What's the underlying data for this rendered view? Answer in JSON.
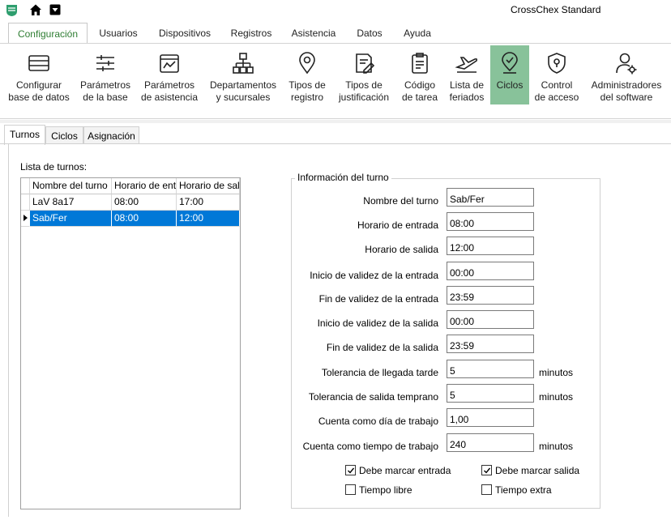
{
  "app": {
    "title": "CrossChex Standard"
  },
  "ribbon_tabs": [
    "Configuración",
    "Usuarios",
    "Dispositivos",
    "Registros",
    "Asistencia",
    "Datos",
    "Ayuda"
  ],
  "ribbon_buttons": [
    "Configurar\nbase de datos",
    "Parámetros\nde la base",
    "Parámetros\nde asistencia",
    "Departamentos\ny sucursales",
    "Tipos de\nregistro",
    "Tipos de\njustificación",
    "Código\nde tarea",
    "Lista de\nferiados",
    "Ciclos",
    "Control\nde acceso",
    "Administradores\ndel software"
  ],
  "sub_tabs": [
    "Turnos",
    "Ciclos",
    "Asignación"
  ],
  "shift_list": {
    "label": "Lista de turnos:",
    "columns": [
      "Nombre del turno",
      "Horario de ent",
      "Horario de sal"
    ],
    "rows": [
      [
        "LaV 8a17",
        "08:00",
        "17:00"
      ],
      [
        "Sab/Fer",
        "08:00",
        "12:00"
      ]
    ]
  },
  "shift_info": {
    "title": "Información del turno",
    "fields": [
      {
        "label": "Nombre del turno",
        "value": "Sab/Fer",
        "unit": ""
      },
      {
        "label": "Horario de entrada",
        "value": "08:00",
        "unit": ""
      },
      {
        "label": "Horario de salida",
        "value": "12:00",
        "unit": ""
      },
      {
        "label": "Inicio de validez de la entrada",
        "value": "00:00",
        "unit": ""
      },
      {
        "label": "Fin de validez de la entrada",
        "value": "23:59",
        "unit": ""
      },
      {
        "label": "Inicio de validez de la salida",
        "value": "00:00",
        "unit": ""
      },
      {
        "label": "Fin de validez de la salida",
        "value": "23:59",
        "unit": ""
      },
      {
        "label": "Tolerancia de llegada tarde",
        "value": "5",
        "unit": "minutos"
      },
      {
        "label": "Tolerancia de salida temprano",
        "value": "5",
        "unit": "minutos"
      },
      {
        "label": "Cuenta como día de trabajo",
        "value": "1,00",
        "unit": ""
      },
      {
        "label": "Cuenta como tiempo de trabajo",
        "value": "240",
        "unit": "minutos"
      }
    ],
    "checkboxes": [
      {
        "label": "Debe marcar entrada",
        "checked": true
      },
      {
        "label": "Debe marcar salida",
        "checked": true
      },
      {
        "label": "Tiempo libre",
        "checked": false
      },
      {
        "label": "Tiempo extra",
        "checked": false
      }
    ]
  },
  "colors": {
    "accent": "#2e7d32",
    "active_ribbon": "#88c29a",
    "selection": "#0078d7"
  }
}
